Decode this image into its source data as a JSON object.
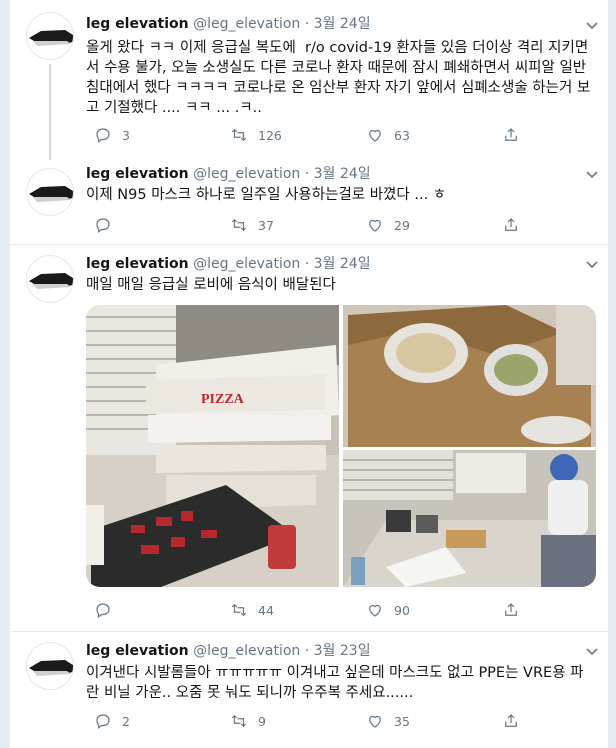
{
  "tweets": [
    {
      "name": "leg elevation",
      "handle": "@leg_elevation",
      "dot": "·",
      "date": "3월 24일",
      "text": "올게 왔다 ㅋㅋ 이제 응급실 복도에  r/o covid-19 환자들 있음 더이상 격리 지키면서 수용 불가, 오늘 소생실도 다른 코로나 환자 때문에 잠시 폐쇄하면서 씨피알 일반 침대에서 했다 ㅋㅋㅋㅋ 코로나로 온 임산부 환자 자기 앞에서 심폐소생술 하는거 보고 기절했다 .... ㅋㅋ ... .ㅋ..",
      "replies": "3",
      "retweets": "126",
      "likes": "63"
    },
    {
      "name": "leg elevation",
      "handle": "@leg_elevation",
      "dot": "·",
      "date": "3월 24일",
      "text": "이제 N95 마스크 하나로 일주일 사용하는걸로 바꼈다 ... ㅎ",
      "replies": "",
      "retweets": "37",
      "likes": "29"
    },
    {
      "name": "leg elevation",
      "handle": "@leg_elevation",
      "dot": "·",
      "date": "3월 24일",
      "text": "매일 매일 응급실 로비에 음식이 배달된다",
      "replies": "",
      "retweets": "44",
      "likes": "90",
      "pizza_box_text": "PIZZA"
    },
    {
      "name": "leg elevation",
      "handle": "@leg_elevation",
      "dot": "·",
      "date": "3월 23일",
      "text": "이겨낸다 시발롬들아 ㅠㅠㅠㅠㅠ 이겨내고 싶은데 마스크도 없고 PPE는 VRE용 파란 비닐 가운.. 오줌 못 눠도 되니까 우주복 주세요......",
      "replies": "2",
      "retweets": "9",
      "likes": "35"
    }
  ],
  "colors": {
    "accent": "#1da1f2",
    "muted": "#657786",
    "separator": "#e6ecf0"
  },
  "icons": [
    "reply-icon",
    "retweet-icon",
    "like-icon",
    "share-icon",
    "chevron-down-icon"
  ]
}
